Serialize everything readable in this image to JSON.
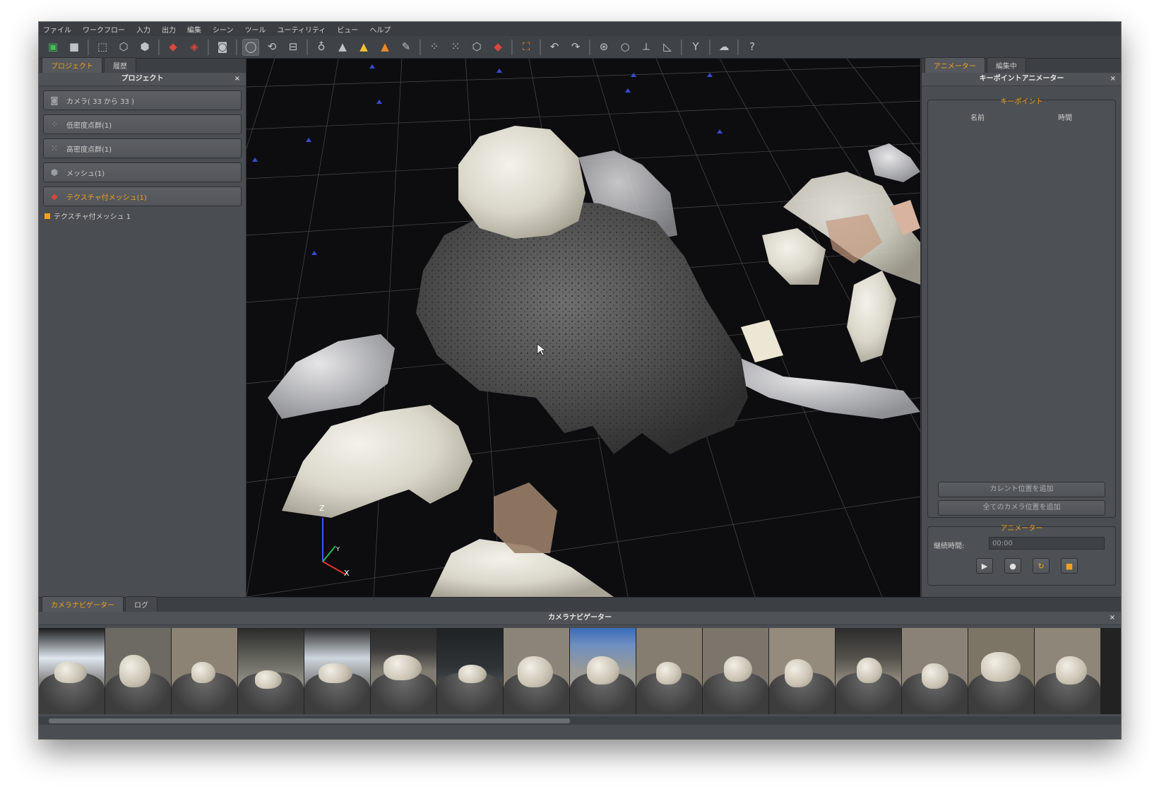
{
  "menu": {
    "items": [
      "ファイル",
      "ワークフロー",
      "入力",
      "出力",
      "編集",
      "シーン",
      "ツール",
      "ユーティリティ",
      "ビュー",
      "ヘルプ"
    ]
  },
  "left_panel": {
    "tabs": [
      "プロジェクト",
      "履歴"
    ],
    "title": "プロジェクト",
    "close": "×",
    "items": [
      {
        "label": "カメラ( 33 から 33 )",
        "icon": "camera-icon"
      },
      {
        "label": "低密度点群(1)",
        "icon": "sparse-cloud-icon"
      },
      {
        "label": "高密度点群(1)",
        "icon": "dense-cloud-icon"
      },
      {
        "label": "メッシュ(1)",
        "icon": "mesh-icon"
      },
      {
        "label": "テクスチャ付メッシュ(1)",
        "icon": "textured-mesh-icon"
      }
    ],
    "tree_child": "テクスチャ付メッシュ 1"
  },
  "right_panel": {
    "tabs": [
      "アニメーター",
      "編集中"
    ],
    "title": "キーポイントアニメーター",
    "close": "×",
    "keypoint_group": "キーポイント",
    "col_name": "名前",
    "col_time": "時間",
    "add_current": "カレント位置を追加",
    "add_all_cameras": "全てのカメラ位置を追加",
    "animator_group": "アニメーター",
    "duration_label": "継続時間:",
    "duration_value": "00:00"
  },
  "viewport": {
    "axis_z": "Z",
    "axis_y": "Y",
    "axis_x": "X"
  },
  "bottom_panel": {
    "tabs": [
      "カメラナビゲーター",
      "ログ"
    ],
    "title": "カメラナビゲーター",
    "close": "×",
    "thumbnail_count": 16
  },
  "colors": {
    "accent": "#f0a020",
    "panel": "#4a4d51",
    "viewport_bg": "#0d0d10"
  }
}
